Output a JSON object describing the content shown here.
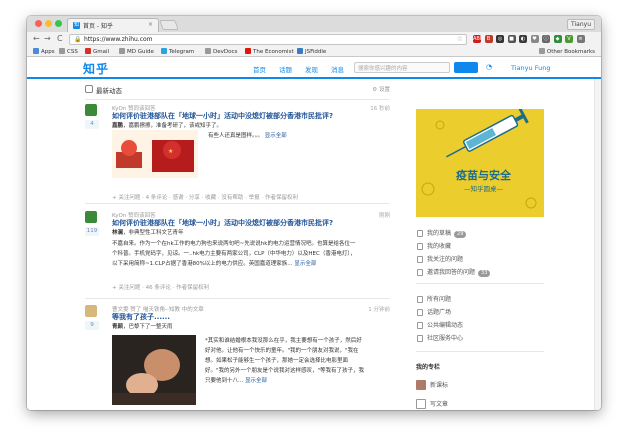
{
  "browser": {
    "tab_title": "首页 - 知乎",
    "tab_favicon": "知",
    "tab_close": "×",
    "profile": "Tianyu",
    "url": "https://www.zhihu.com",
    "nav": {
      "back": "←",
      "forward": "→",
      "reload": "C"
    },
    "extensions": [
      {
        "label": "ABP",
        "color": "#d21b1b"
      },
      {
        "label": "B",
        "color": "#c0392b"
      },
      {
        "label": "◎",
        "color": "#333333"
      },
      {
        "label": "■",
        "color": "#555555"
      },
      {
        "label": "◐",
        "color": "#3b3b3b"
      },
      {
        "label": "♥",
        "color": "#888888"
      },
      {
        "label": "ⓘ",
        "color": "#666666"
      },
      {
        "label": "◆",
        "color": "#2c8f3a"
      },
      {
        "label": "V",
        "color": "#4a9b2f"
      },
      {
        "label": "≡",
        "color": "#777777"
      }
    ],
    "bookmarks": [
      {
        "label": "Apps",
        "color": "#4a89dc"
      },
      {
        "label": "CSS",
        "color": "#999999"
      },
      {
        "label": "Gmail",
        "color": "#d93025"
      },
      {
        "label": "MD Guide",
        "color": "#999999"
      },
      {
        "label": "Telegram",
        "color": "#2aa3e0"
      },
      {
        "label": "DevDocs",
        "color": "#999999"
      },
      {
        "label": "The Economist",
        "color": "#e3120b"
      },
      {
        "label": "JSFiddle",
        "color": "#3c7ac1"
      }
    ],
    "other_bookmarks": "Other Bookmarks"
  },
  "header": {
    "logo": "知乎",
    "nav_links": [
      "首页",
      "话题",
      "发现",
      "消息"
    ],
    "search_placeholder": "搜索你感兴趣的内容",
    "username": "Tianyu Fung"
  },
  "feed": {
    "title": "最新动态",
    "settings": "设置",
    "items": [
      {
        "meta": "KyOn 赞同该回答",
        "time": "16 秒前",
        "question": "如何评价驻港部队在「地球一小时」活动中没熄灯被部分香港市民批评?",
        "votes": "4",
        "answerer": "嘉鹏",
        "answerer_bio": "嘉鹏擦擦，准备考研了，该戒知乎了。",
        "excerpt": "有些人还真是图样。。。",
        "show_all": "显示全部",
        "actions": [
          "+ 关注问题",
          "4 条评论",
          "感谢",
          "分享",
          "收藏",
          "没有帮助",
          "举报",
          "作者保留权利"
        ]
      },
      {
        "meta": "KyOn 赞同该回答",
        "time": "刚刚",
        "question": "如何评价驻港部队在「地球一小时」活动中没熄灯被部分香港市民批评?",
        "votes": "119",
        "answerer": "林澜",
        "answerer_bio": "非典型性工科文艺青年",
        "text_line1": "不嘉自来。作为一个在hk工作的电力狗也来说两句吧~先说说hk的电力运营情况吧。也算是给各位一",
        "text_line2": "个科普。手机党码字，见谅。一..hk电力主要有两家公司，CLP（中华电力）以及HEC（香港电灯），",
        "text_line3": "以下采用简称~1.CLP占据了香港80%以上的电力供应。英国嘉道理家族...",
        "show_all": "显示全部",
        "actions": [
          "+ 关注问题",
          "46 条评论",
          "作者保留权利"
        ]
      },
      {
        "meta": "曹文雯 赞了 喵天铁角--知教 中的文章",
        "time": "1 分钟前",
        "question": "等我有了孩子......",
        "votes": "9",
        "answerer": "青颜",
        "answerer_bio": "巴黎下了一整天雨",
        "text_line1": "*其实和谁结婚根本我没那么在乎，我主要想有一个孩子，然后好",
        "text_line2": "好对他。让他有一个快乐的童年。\"我的一个朋友对我说，\"我在",
        "text_line3": "想。如果松子能够生一个孩子，那她一定会选择比电影里面",
        "text_line4": "好。\"我的另外一个朋友是个说我对这样感叹，\"等我有了孩子，我",
        "text_line5": "只要他到十八...",
        "show_all": "显示全部"
      }
    ]
  },
  "sidebar": {
    "banner_title": "疫苗与安全",
    "banner_subtitle": "—知乎圆桌—",
    "group1": [
      {
        "label": "我的草稿",
        "count": "29"
      },
      {
        "label": "我的收藏",
        "count": ""
      },
      {
        "label": "我关注的问题",
        "count": ""
      },
      {
        "label": "邀请我回答的问题",
        "count": "33"
      }
    ],
    "group2": [
      {
        "label": "所有问题"
      },
      {
        "label": "话题广场"
      },
      {
        "label": "公共编辑动态"
      },
      {
        "label": "社区服务中心"
      }
    ],
    "columns_heading": "我的专栏",
    "columns": [
      {
        "label": "新课标"
      },
      {
        "label": "写文章"
      }
    ]
  }
}
